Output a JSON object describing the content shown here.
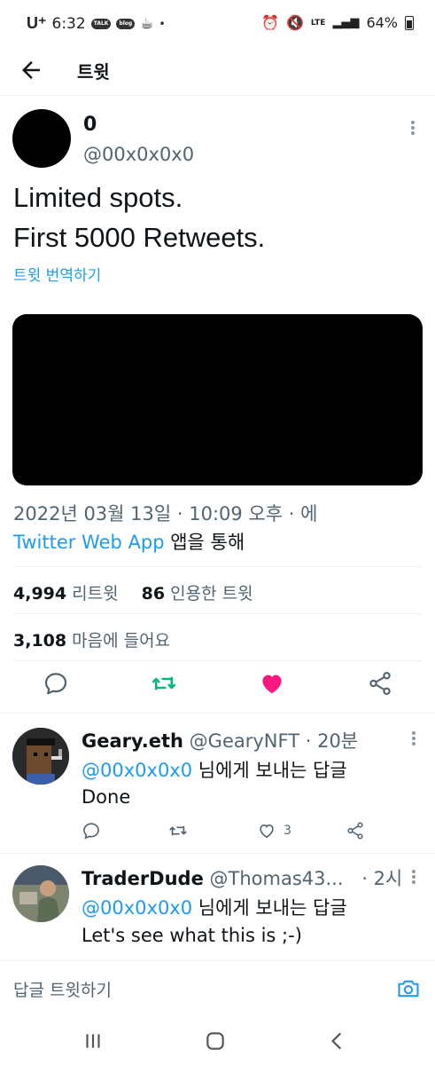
{
  "status_bar": {
    "carrier": "U⁺",
    "time": "6:32",
    "app_badges": [
      "TALK",
      "blog"
    ],
    "dot": "•",
    "network": "LTE",
    "battery": "64%"
  },
  "header": {
    "title": "트윗"
  },
  "tweet": {
    "author_name": "0",
    "author_handle": "@00x0x0x0",
    "text_line1": "Limited spots.",
    "text_line2": "First 5000 Retweets.",
    "translate_label": "트윗 번역하기",
    "timestamp": "2022년 03월 13일 · 10:09 오후 · 에",
    "via_app": "Twitter Web App",
    "via_suffix": " 앱을 통해",
    "retweets_count": "4,994",
    "retweets_label": "리트윗",
    "quotes_count": "86",
    "quotes_label": "인용한 트윗",
    "likes_count": "3,108",
    "likes_label": "마음에 들어요"
  },
  "replies": [
    {
      "name": "Geary.eth",
      "handle": "@GearyNFT",
      "time": "· 20분",
      "reply_to_mention": "@00x0x0x0",
      "reply_to_suffix": " 님에게 보내는 답글",
      "text": "Done",
      "like_count": "3"
    },
    {
      "name": "TraderDude",
      "handle": "@Thomas43...",
      "time": "· 2시",
      "reply_to_mention": "@00x0x0x0",
      "reply_to_suffix": " 님에게 보내는 답글",
      "text": "Let's see what this is ;-)"
    }
  ],
  "composer": {
    "placeholder": "답글 트윗하기"
  },
  "colors": {
    "accent": "#1d9bf0",
    "retweet": "#00ba7c",
    "like": "#f91880",
    "muted": "#536471"
  }
}
